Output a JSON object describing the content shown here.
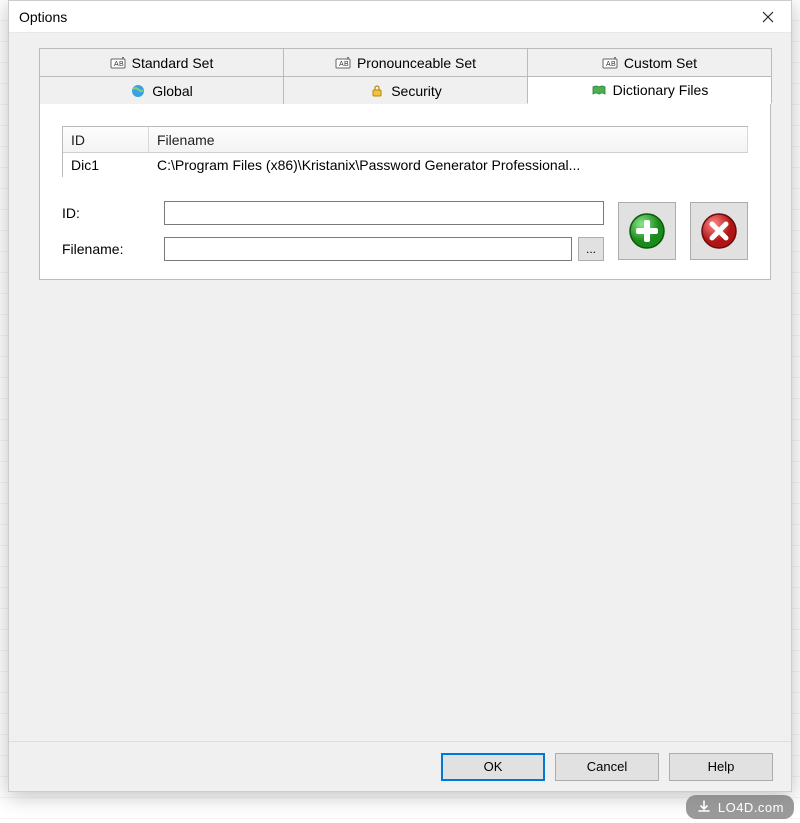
{
  "window": {
    "title": "Options"
  },
  "tabs": {
    "row1": [
      {
        "label": "Standard Set"
      },
      {
        "label": "Pronounceable Set"
      },
      {
        "label": "Custom Set"
      }
    ],
    "row2": [
      {
        "label": "Global"
      },
      {
        "label": "Security"
      },
      {
        "label": "Dictionary Files"
      }
    ],
    "active": "Dictionary Files"
  },
  "list": {
    "columns": {
      "id": "ID",
      "filename": "Filename"
    },
    "rows": [
      {
        "id": "Dic1",
        "filename": "C:\\Program Files (x86)\\Kristanix\\Password Generator Professional..."
      }
    ]
  },
  "form": {
    "id_label": "ID:",
    "id_value": "",
    "filename_label": "Filename:",
    "filename_value": "",
    "browse_label": "..."
  },
  "buttons": {
    "ok": "OK",
    "cancel": "Cancel",
    "help": "Help"
  },
  "watermark": "LO4D.com"
}
